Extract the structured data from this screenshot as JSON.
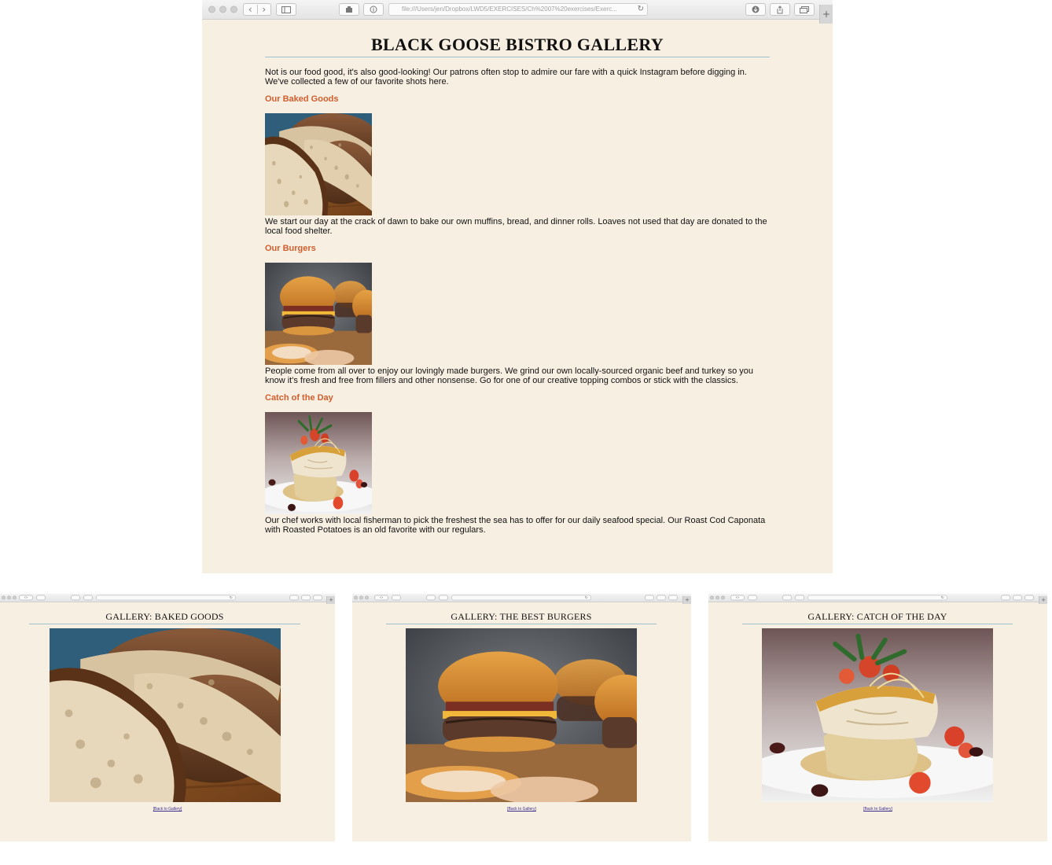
{
  "main_window": {
    "address": "file:///Users/jen/Dropbox/LWD5/EXERCISES/Ch%2007%20exercises/Exerc...",
    "title": "BLACK GOOSE BISTRO GALLERY",
    "intro": "Not is our food good, it's also good-looking! Our patrons often stop to admire our fare with a quick Instagram before digging in. We've collected a few of our favorite shots here.",
    "sections": [
      {
        "heading": "Our Baked Goods",
        "text": "We start our day at the crack of dawn to bake our own muffins, bread, and dinner rolls. Loaves not used that day are donated to the local food shelter."
      },
      {
        "heading": "Our Burgers",
        "text": "People come from all over to enjoy our lovingly made burgers. We grind our own locally-sourced organic beef and turkey so you know it's fresh and free from fillers and other nonsense. Go for one of our creative topping combos or stick with the classics."
      },
      {
        "heading": "Catch of the Day",
        "text": "Our chef works with local fisherman to pick the freshest the sea has to offer for our daily seafood special. Our Roast Cod Caponata with Roasted Potatoes is an old favorite with our regulars."
      }
    ]
  },
  "detail_windows": [
    {
      "title": "GALLERY: BAKED GOODS",
      "link": "[Back to Gallery]"
    },
    {
      "title": "GALLERY: THE BEST BURGERS",
      "link": "[Back to Gallery]"
    },
    {
      "title": "GALLERY: CATCH OF THE DAY",
      "link": "[Back to Gallery]"
    }
  ],
  "toolbar": {
    "back_icon": "‹",
    "forward_icon": "›",
    "new_tab_icon": "+"
  },
  "colors": {
    "page_background": "#f8efe3",
    "heading_accent": "#d15e2c",
    "rule": "#9fc2cf",
    "link": "#3a2b8c"
  }
}
